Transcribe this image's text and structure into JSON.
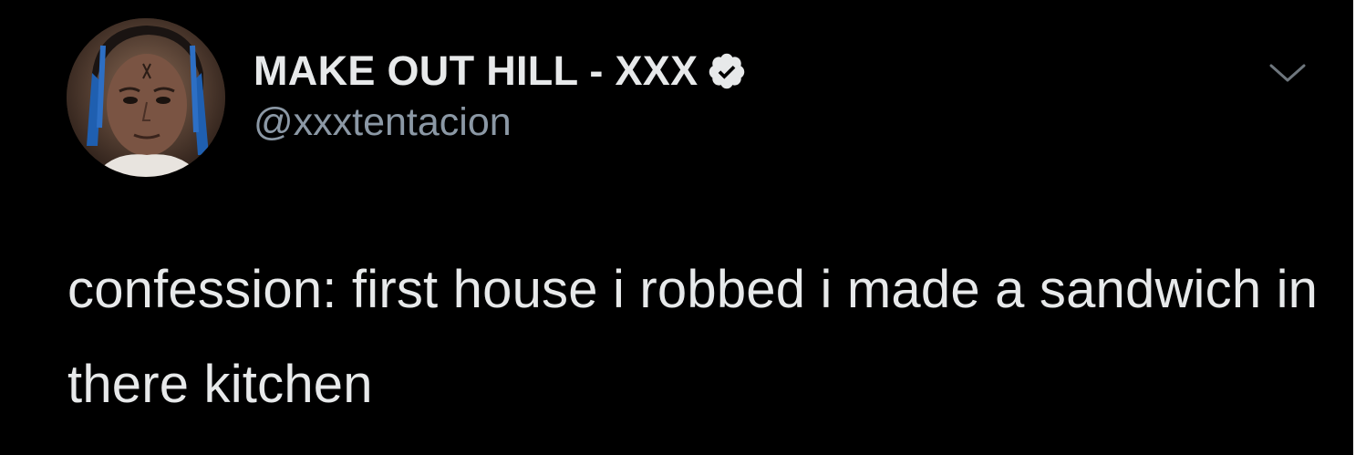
{
  "author": {
    "display_name": "MAKE OUT HILL - XXX",
    "handle": "@xxxtentacion",
    "verified": true,
    "avatar_icon": "profile-photo"
  },
  "tweet": {
    "text": "confession: first house i robbed i made a sandwich in there kitchen"
  },
  "icons": {
    "verified": "verified-badge-icon",
    "more": "chevron-down-icon"
  },
  "colors": {
    "background": "#000000",
    "text": "#e7e9ea",
    "secondary_text": "#8b98a5",
    "caret": "#6e767d"
  }
}
